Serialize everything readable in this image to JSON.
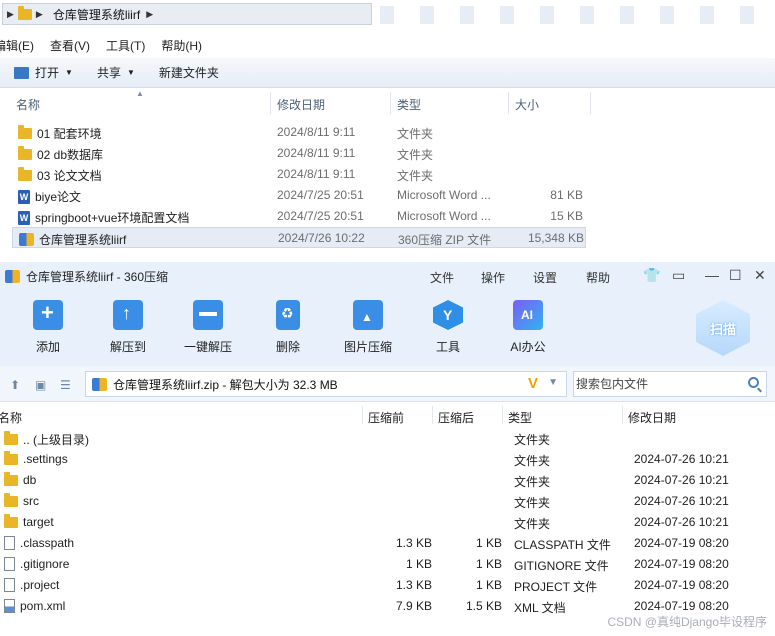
{
  "explorer": {
    "breadcrumb": "仓库管理系统liirf",
    "menu": [
      "编辑(E)",
      "查看(V)",
      "工具(T)",
      "帮助(H)"
    ],
    "toolbar": {
      "open": "打开",
      "share": "共享",
      "new_folder": "新建文件夹"
    },
    "columns": {
      "name": "名称",
      "date": "修改日期",
      "type": "类型",
      "size": "大小"
    },
    "rows": [
      {
        "icon": "folder-icon",
        "name": "01 配套环境",
        "date": "2024/8/11 9:11",
        "type": "文件夹",
        "size": ""
      },
      {
        "icon": "folder-icon",
        "name": "02 db数据库",
        "date": "2024/8/11 9:11",
        "type": "文件夹",
        "size": ""
      },
      {
        "icon": "folder-icon",
        "name": "03 论文文档",
        "date": "2024/8/11 9:11",
        "type": "文件夹",
        "size": ""
      },
      {
        "icon": "word-doc-icon",
        "name": "biye论文",
        "date": "2024/7/25 20:51",
        "type": "Microsoft Word ...",
        "size": "81 KB"
      },
      {
        "icon": "word-doc-icon",
        "name": "springboot+vue环境配置文档",
        "date": "2024/7/25 20:51",
        "type": "Microsoft Word ...",
        "size": "15 KB"
      },
      {
        "icon": "zip-archive-icon",
        "name": "仓库管理系统liirf",
        "date": "2024/7/26 10:22",
        "type": "360压缩 ZIP 文件",
        "size": "15,348 KB"
      }
    ]
  },
  "zip": {
    "title": "仓库管理系统liirf - 360压缩",
    "menu": [
      "文件",
      "操作",
      "设置",
      "帮助"
    ],
    "tools": [
      "添加",
      "解压到",
      "一键解压",
      "删除",
      "图片压缩",
      "工具",
      "AI办公"
    ],
    "scan_label": "扫描",
    "path": "仓库管理系统liirf.zip - 解包大小为 32.3 MB",
    "search_placeholder": "搜索包内文件",
    "columns": {
      "name": "名称",
      "before": "压缩前",
      "after": "压缩后",
      "type": "类型",
      "modified": "修改日期"
    },
    "rows": [
      {
        "icon": "folder-icon",
        "name": ".. (上级目录)",
        "before": "",
        "after": "",
        "type": "文件夹",
        "modified": ""
      },
      {
        "icon": "folder-icon",
        "name": ".settings",
        "before": "",
        "after": "",
        "type": "文件夹",
        "modified": "2024-07-26 10:21"
      },
      {
        "icon": "folder-icon",
        "name": "db",
        "before": "",
        "after": "",
        "type": "文件夹",
        "modified": "2024-07-26 10:21"
      },
      {
        "icon": "folder-icon",
        "name": "src",
        "before": "",
        "after": "",
        "type": "文件夹",
        "modified": "2024-07-26 10:21"
      },
      {
        "icon": "folder-icon",
        "name": "target",
        "before": "",
        "after": "",
        "type": "文件夹",
        "modified": "2024-07-26 10:21"
      },
      {
        "icon": "file-icon",
        "name": ".classpath",
        "before": "1.3 KB",
        "after": "1 KB",
        "type": "CLASSPATH 文件",
        "modified": "2024-07-19 08:20"
      },
      {
        "icon": "file-icon",
        "name": ".gitignore",
        "before": "1 KB",
        "after": "1 KB",
        "type": "GITIGNORE 文件",
        "modified": "2024-07-19 08:20"
      },
      {
        "icon": "file-icon",
        "name": ".project",
        "before": "1.3 KB",
        "after": "1 KB",
        "type": "PROJECT 文件",
        "modified": "2024-07-19 08:20"
      },
      {
        "icon": "xml-file-icon",
        "name": "pom.xml",
        "before": "7.9 KB",
        "after": "1.5 KB",
        "type": "XML 文档",
        "modified": "2024-07-19 08:20"
      }
    ]
  },
  "watermark": "CSDN @真纯Django毕设程序"
}
